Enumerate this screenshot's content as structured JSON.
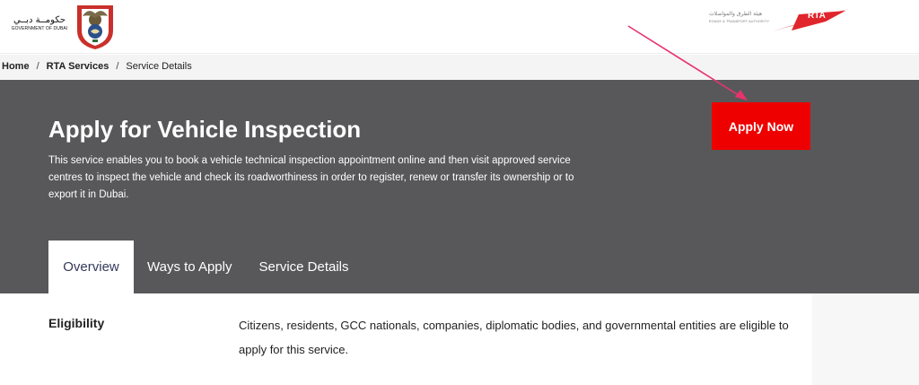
{
  "header": {
    "gov_logo": {
      "arabic": "حكومــة دبــي",
      "english": "GOVERNMENT OF DUBAI",
      "icon": "dubai-emblem-icon"
    },
    "rta_logo": {
      "arabic": "هيئة الطرق والمواصلات",
      "english": "ROADS & TRANSPORT AUTHORITY",
      "mark": "RTA",
      "icon": "rta-mark-icon"
    }
  },
  "breadcrumb": {
    "items": [
      "Home",
      "RTA Services",
      "Service Details"
    ],
    "separator": "/"
  },
  "hero": {
    "title": "Apply for Vehicle Inspection",
    "description": "This service enables you to book a vehicle technical inspection appointment online and then visit approved service centres to inspect the vehicle and check its roadworthiness in order to register, renew or transfer its ownership or to export it in Dubai.",
    "apply_button": "Apply Now"
  },
  "tabs": [
    {
      "label": "Overview",
      "active": true
    },
    {
      "label": "Ways to Apply",
      "active": false
    },
    {
      "label": "Service Details",
      "active": false
    }
  ],
  "eligibility": {
    "label": "Eligibility",
    "text": "Citizens, residents, GCC nationals, companies, diplomatic bodies, and governmental entities are eligible to apply for this service."
  },
  "colors": {
    "hero_bg": "#58585a",
    "accent_red": "#ee0000",
    "annotation_arrow": "#e8336d",
    "active_tab_text": "#333a5c"
  }
}
